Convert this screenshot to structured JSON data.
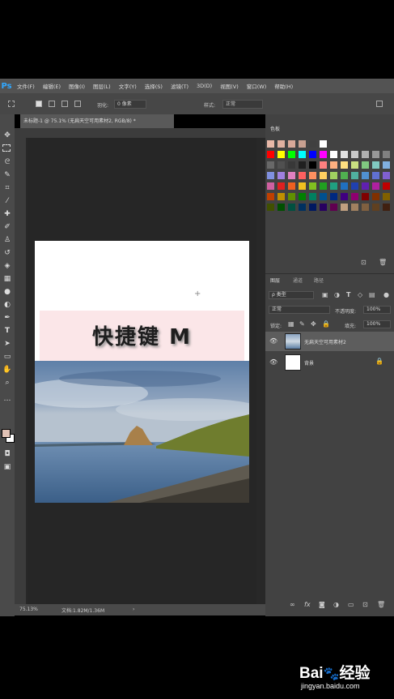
{
  "app": {
    "logo": "Ps"
  },
  "menu": [
    "文件(F)",
    "编辑(E)",
    "图像(I)",
    "图层(L)",
    "文字(Y)",
    "选择(S)",
    "滤镜(T)",
    "3D(D)",
    "视图(V)",
    "窗口(W)",
    "帮助(H)"
  ],
  "options": {
    "feather_label": "羽化:",
    "feather_value": "0 像素",
    "style_label": "样式:",
    "style_value": "正常"
  },
  "document": {
    "tab_title": "未标题-1 @ 75.1% (无扁天空可用素材2, RGB/8) *",
    "headline": "快捷键 M",
    "zoom": "75.13%",
    "doc_info": "文档:1.82M/1.36M"
  },
  "swatches_panel": {
    "title": "色板"
  },
  "layers_panel": {
    "tabs": [
      "图层",
      "通道",
      "路径"
    ],
    "filter_kind": "ρ 类型",
    "blend_mode": "正常",
    "opacity_label": "不透明度:",
    "opacity_value": "100%",
    "lock_label": "锁定:",
    "fill_label": "填充:",
    "fill_value": "100%",
    "layers": [
      {
        "name": "无扁天空可用素材2",
        "selected": true
      },
      {
        "name": "背景",
        "selected": false
      }
    ],
    "footer_icons": [
      "link-icon",
      "fx-icon",
      "mask-icon",
      "adjustment-icon",
      "group-icon",
      "new-layer-icon",
      "trash-icon"
    ]
  },
  "watermark": {
    "brand": "Bai",
    "brand2": "经验",
    "url": "jingyan.baidu.com"
  },
  "colors": {
    "accent": "#31a8ff",
    "foreground": "#e2c3b6",
    "background": "#ffffff"
  },
  "swatch_rows": [
    [
      "#e8b8a8",
      "#e0b0a0",
      "#d8a898",
      "#c8a090",
      "#404040",
      "#ffffff"
    ],
    [
      "#ff0000",
      "#ffff00",
      "#00ff00",
      "#00ffff",
      "#0000ff",
      "#ff00ff",
      "#ffffff",
      "#e0e0e0",
      "#c8c8c8",
      "#b0b0b0",
      "#989898",
      "#808080"
    ],
    [
      "#686868",
      "#505050",
      "#383838",
      "#202020",
      "#000000",
      "#ff8080",
      "#ffb080",
      "#ffe080",
      "#c8e080",
      "#80c880",
      "#80c8c0",
      "#80b0e0"
    ],
    [
      "#8090e0",
      "#a080e0",
      "#e080c0",
      "#ff6060",
      "#ff9060",
      "#ffd060",
      "#a0d060",
      "#50b050",
      "#50b0a0",
      "#5090d0",
      "#6070d0",
      "#8060d0"
    ],
    [
      "#d060a0",
      "#e02020",
      "#f06020",
      "#f0c020",
      "#80c020",
      "#20a020",
      "#20a080",
      "#2070c0",
      "#2040b0",
      "#6020b0",
      "#b020a0",
      "#c00000"
    ],
    [
      "#c04000",
      "#c09000",
      "#609000",
      "#008000",
      "#008060",
      "#005090",
      "#002880",
      "#400080",
      "#900070",
      "#800000",
      "#803000",
      "#806000"
    ],
    [
      "#405000",
      "#005000",
      "#005040",
      "#003060",
      "#001860",
      "#280060",
      "#600050",
      "#c0a080",
      "#a08060",
      "#806040",
      "#604020",
      "#402010"
    ]
  ]
}
